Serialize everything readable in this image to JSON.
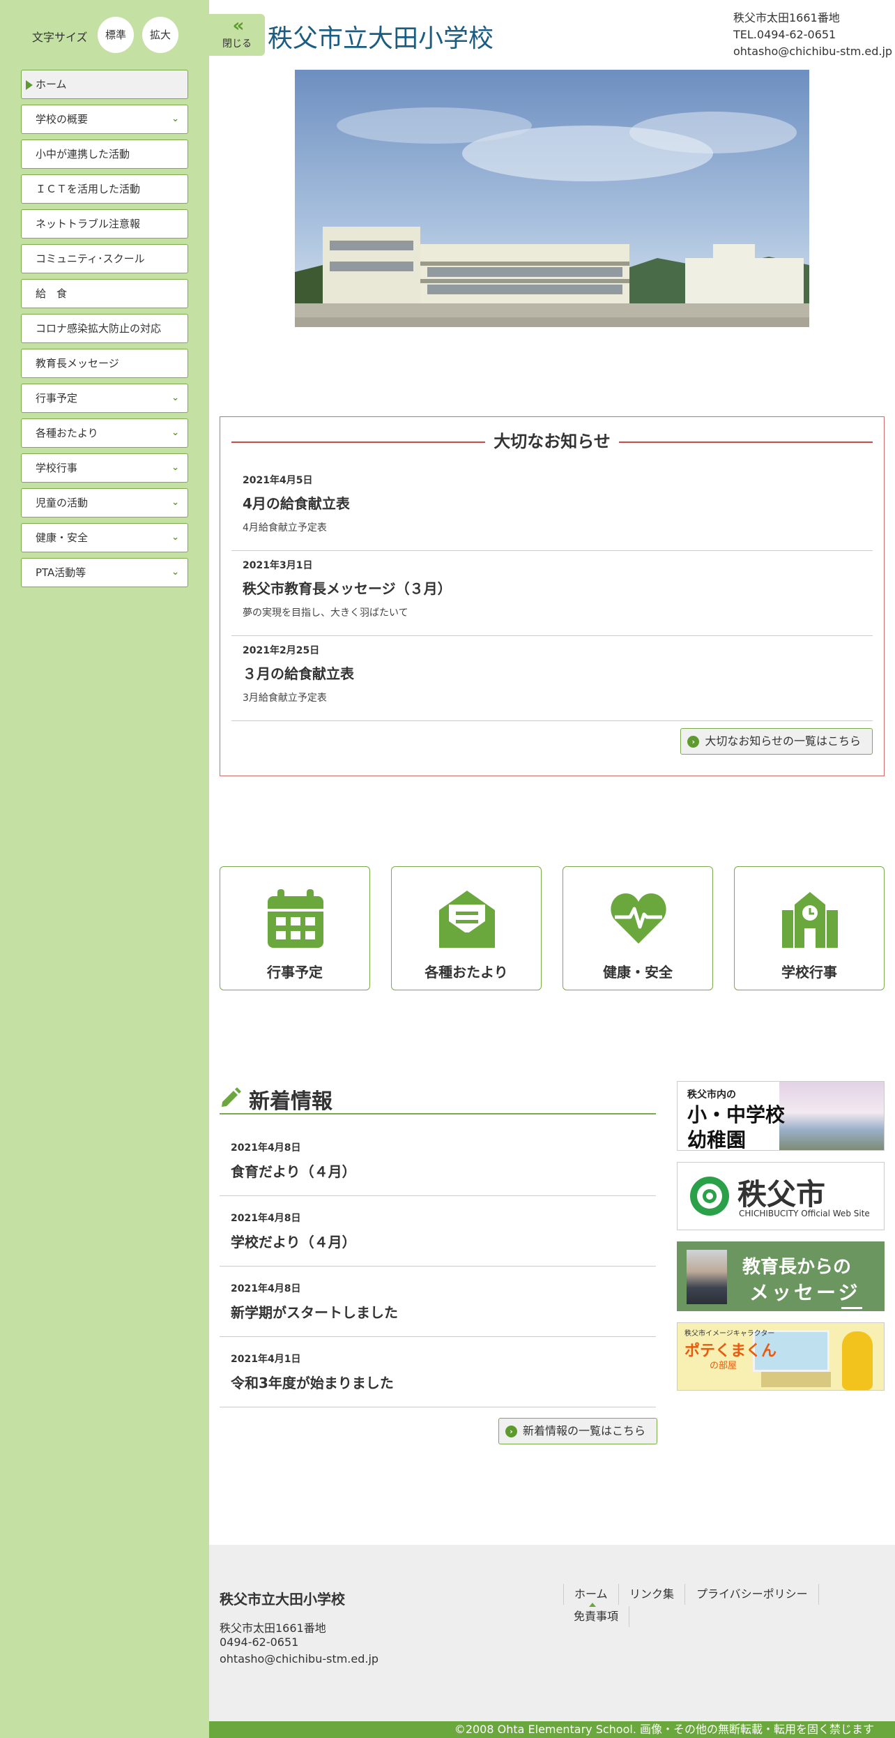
{
  "sidebar": {
    "font_size_label": "文字サイズ",
    "font_size_normal": "標準",
    "font_size_large": "拡大",
    "items": [
      {
        "label": "ホーム"
      },
      {
        "label": "学校の概要"
      },
      {
        "label": "小中が連携した活動"
      },
      {
        "label": "ＩＣＴを活用した活動"
      },
      {
        "label": "ネットトラブル注意報"
      },
      {
        "label": "コミュニティ･スクール"
      },
      {
        "label": "給　食"
      },
      {
        "label": "コロナ感染拡大防止の対応"
      },
      {
        "label": "教育長メッセージ"
      },
      {
        "label": "行事予定"
      },
      {
        "label": "各種おたより"
      },
      {
        "label": "学校行事"
      },
      {
        "label": "児童の活動"
      },
      {
        "label": "健康・安全"
      },
      {
        "label": "PTA活動等"
      }
    ]
  },
  "header": {
    "close_label": "閉じる",
    "title": "秩父市立大田小学校",
    "address": "秩父市太田1661番地",
    "tel": "TEL.0494-62-0651",
    "email": "ohtasho@chichibu-stm.ed.jp"
  },
  "notices": {
    "heading": "大切なお知らせ",
    "items": [
      {
        "date": "2021年4月5日",
        "title": "4月の給食献立表",
        "sub": "4月給食献立予定表"
      },
      {
        "date": "2021年3月1日",
        "title": "秩父市教育長メッセージ（３月）",
        "sub": "夢の実現を目指し、大きく羽ばたいて"
      },
      {
        "date": "2021年2月25日",
        "title": "３月の給食献立表",
        "sub": "3月給食献立予定表"
      }
    ],
    "more_label": "大切なお知らせの一覧はこちら"
  },
  "quick_links": [
    {
      "label": "行事予定",
      "icon": "calendar-icon"
    },
    {
      "label": "各種おたより",
      "icon": "envelope-icon"
    },
    {
      "label": "健康・安全",
      "icon": "heartbeat-icon"
    },
    {
      "label": "学校行事",
      "icon": "school-icon"
    }
  ],
  "news": {
    "heading": "新着情報",
    "items": [
      {
        "date": "2021年4月8日",
        "title": "食育だより（４月）"
      },
      {
        "date": "2021年4月8日",
        "title": "学校だより（４月）"
      },
      {
        "date": "2021年4月8日",
        "title": "新学期がスタートしました"
      },
      {
        "date": "2021年4月1日",
        "title": "令和3年度が始まりました"
      }
    ],
    "more_label": "新着情報の一覧はこちら"
  },
  "banners": {
    "b1_small": "秩父市内の",
    "b1_line1": "小・中学校",
    "b1_line2": "幼稚園",
    "b2_main": "秩父市",
    "b2_sub": "CHICHIBUCITY Official Web Site",
    "b3_line1": "教育長からの",
    "b3_line2": "メッセージ",
    "b4_small": "秩父市イメージキャラクター",
    "b4_title": "ポテくまくん",
    "b4_sub": "の部屋"
  },
  "footer": {
    "name": "秩父市立大田小学校",
    "address": "秩父市太田1661番地",
    "tel": "0494-62-0651",
    "email": "ohtasho@chichibu-stm.ed.jp",
    "links": [
      "ホーム",
      "リンク集",
      "プライバシーポリシー",
      "免責事項"
    ],
    "copyright": "©2008 Ohta Elementary School. 画像・その他の無断転載・転用を固く禁じます"
  },
  "colors": {
    "sidebar_bg": "#c4e0a2",
    "accent_green": "#6aa73c",
    "title_blue": "#1b5d82",
    "notice_red": "#cf6b6b"
  }
}
